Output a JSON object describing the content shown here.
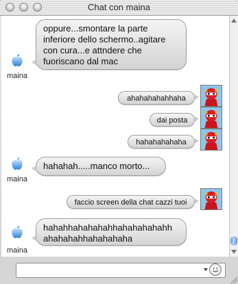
{
  "window": {
    "title": "Chat con maina"
  },
  "contact": {
    "name": "maina"
  },
  "messages": [
    {
      "direction": "in",
      "text": "oppure...smontare la parte inferiore dello schermo..agitare con cura...e attndere che fuoriscano dal mac"
    },
    {
      "direction": "out",
      "text": "ahahahahahhaha"
    },
    {
      "direction": "out",
      "text": "dai posta"
    },
    {
      "direction": "out",
      "text": "hahahahahaha"
    },
    {
      "direction": "in",
      "text": "hahahah.....manco morto..."
    },
    {
      "direction": "out",
      "text": "faccio screen della chat cazzi tuoi"
    },
    {
      "direction": "in",
      "text": "hahahhahahahahhahahahahahh ahahahahhahahahaha"
    }
  ],
  "input": {
    "value": ""
  },
  "icons": {
    "buddy": "apple-logo-icon",
    "self": "superhero-avatar-icon",
    "emoticon": "smiley-icon"
  }
}
